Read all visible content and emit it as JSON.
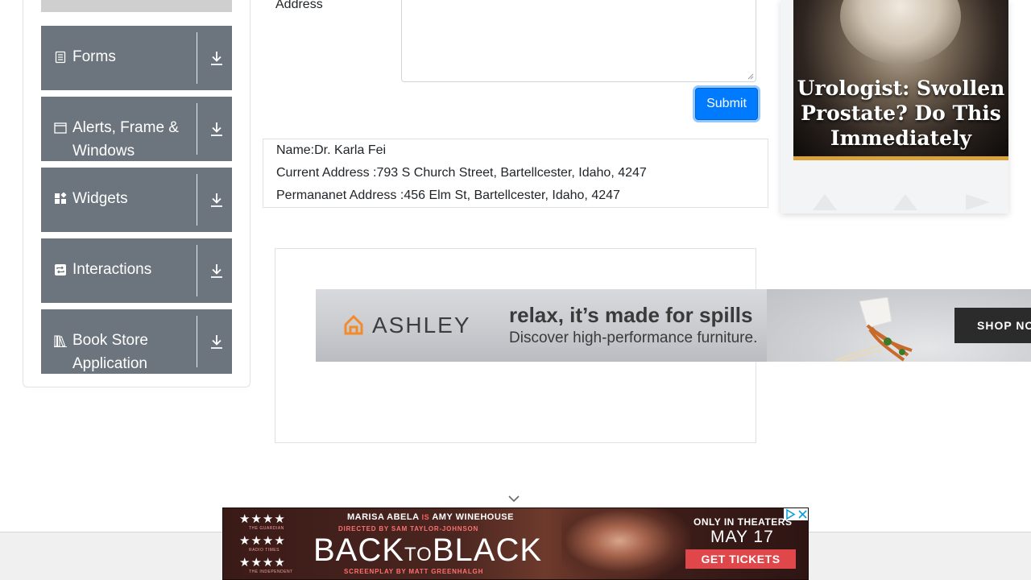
{
  "sidebar": {
    "groups": [
      {
        "label": "Forms",
        "icon": "document-icon"
      },
      {
        "label": "Alerts, Frame & Windows",
        "icon": "window-icon"
      },
      {
        "label": "Widgets",
        "icon": "widgets-icon"
      },
      {
        "label": "Interactions",
        "icon": "interactions-icon"
      },
      {
        "label": "Book Store Application",
        "icon": "books-icon"
      }
    ]
  },
  "form": {
    "address_label": "Address",
    "submit_label": "Submit"
  },
  "output": {
    "name": "Name:Dr. Karla Fei",
    "current_address": "Current Address :793 S Church Street, Bartellcester, Idaho, 4247",
    "permanent_address": "Permananet Address :456 Elm St, Bartellcester, Idaho, 4247"
  },
  "ads": {
    "ashley": {
      "brand": "ASHLEY",
      "headline": "relax, it’s made for spills",
      "subline": "Discover high-performance furniture.",
      "cta": "SHOP NO",
      "brand_color": "#f28a2e"
    },
    "right": {
      "headline": "Urologist: Swollen Prostate? Do This Immediately"
    },
    "bottom": {
      "review_sources": [
        "THE GUARDIAN",
        "RADIO TIMES",
        "THE INDEPENDENT"
      ],
      "stars": "★★★★",
      "cast_1": "MARISA ABELA",
      "cast_is": "IS",
      "cast_2": "AMY WINEHOUSE",
      "director": "DIRECTED BY SAM TAYLOR-JOHNSON",
      "title_back": "BACK",
      "title_to": "TO",
      "title_black": "BLACK",
      "screenplay": "SCREENPLAY BY MATT GREENHALGH",
      "theaters": "ONLY IN THEATERS",
      "date": "MAY 17",
      "cta": "GET TICKETS"
    }
  }
}
